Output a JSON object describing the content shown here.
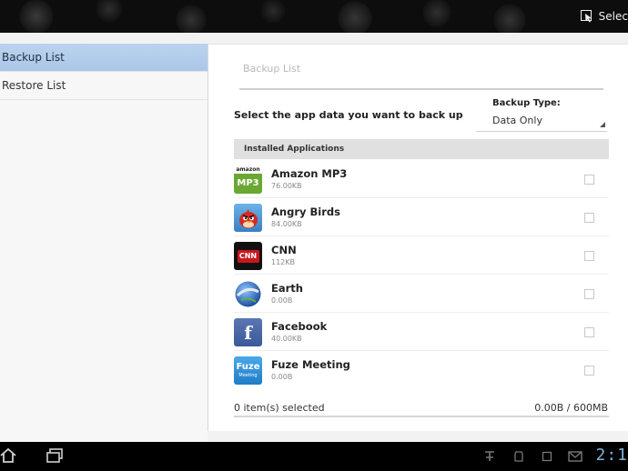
{
  "top_bar": {
    "select_label": "Selec"
  },
  "nav": {
    "items": [
      {
        "label": "Backup List",
        "active": true
      },
      {
        "label": "Restore List",
        "active": false
      }
    ]
  },
  "main": {
    "title": "Backup List",
    "instruction": "Select the app data you want to back up",
    "backup_type": {
      "label": "Backup Type:",
      "value": "Data Only"
    },
    "section_header": "Installed Applications",
    "apps": [
      {
        "name": "Amazon MP3",
        "size": "76.00KB",
        "icon": "amazon-mp3-icon",
        "icon_top_text": "amazon",
        "icon_text": "MP3",
        "color": "#6aa832"
      },
      {
        "name": "Angry Birds",
        "size": "84.00KB",
        "icon": "angry-birds-icon",
        "icon_text": "",
        "color": "#4a8ed0"
      },
      {
        "name": "CNN",
        "size": "112KB",
        "icon": "cnn-icon",
        "icon_text": "CNN",
        "color": "#111111"
      },
      {
        "name": "Earth",
        "size": "0.00B",
        "icon": "earth-icon",
        "icon_text": "",
        "color": "#2f6fc4"
      },
      {
        "name": "Facebook",
        "size": "40.00KB",
        "icon": "facebook-icon",
        "icon_text": "f",
        "color": "#3b5998"
      },
      {
        "name": "Fuze Meeting",
        "size": "0.00B",
        "icon": "fuze-meeting-icon",
        "icon_text": "Fuze",
        "icon_sub_text": "Meeting",
        "color": "#2b8fd6"
      }
    ],
    "footer": {
      "selected": "0 item(s) selected",
      "storage": "0.00B / 600MB"
    }
  },
  "status_bar": {
    "time": "2:1"
  },
  "colors": {
    "nav_active": "#aac7e8",
    "background": "#f2f2f2"
  }
}
